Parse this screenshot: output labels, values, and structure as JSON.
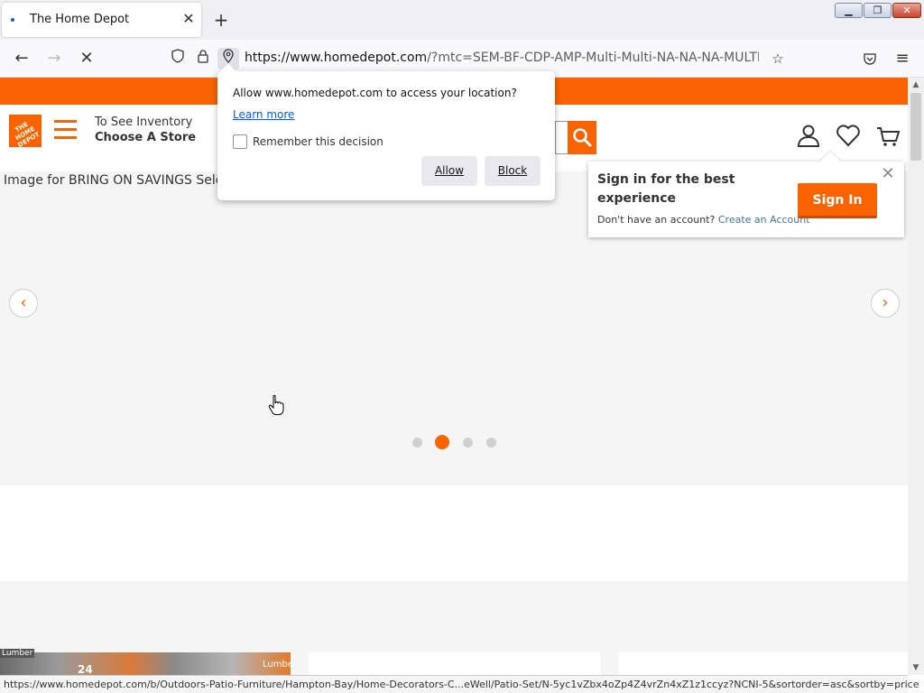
{
  "browser": {
    "tab_title": "The Home Depot",
    "new_tab_glyph": "+",
    "close_tab_glyph": "✕",
    "url_host": "https://www.homedepot.com",
    "url_rest": "/?mtc=SEM-BF-CDP-AMP-Multi-Multi-NA-NA-NA-MULTI-NA-N",
    "back_glyph": "←",
    "forward_glyph": "→",
    "stop_glyph": "✕",
    "bookmark_glyph": "☆",
    "menu_glyph": "≡",
    "status_url": "https://www.homedepot.com/b/Outdoors-Patio-Furniture/Hampton-Bay/Home-Decorators-C...eWell/Patio-Set/N-5yc1vZbx4oZp4Z4vrZn4xZ1z1ccyz?NCNI-5&sortorder=asc&sortby=price"
  },
  "header": {
    "logo_text": "THE HOME DEPOT",
    "store_line1": "To See Inventory",
    "store_line2": "Choose A Store"
  },
  "hero": {
    "alt_text": "Image for BRING ON SAVINGS Select",
    "prev_glyph": "‹",
    "next_glyph": "›",
    "dots_count": 4,
    "active_dot": 2
  },
  "tiles": {
    "label_a": "Lumber",
    "label_b": "24",
    "label_c": "Lumbe"
  },
  "signin_popup": {
    "title": "Sign in for the best experience",
    "no_account": "Don't have an account?",
    "create_link": "Create an Account",
    "button": "Sign In",
    "close_glyph": "✕"
  },
  "permission_popup": {
    "message": "Allow www.homedepot.com to access your location?",
    "learn_more": "Learn more",
    "remember": "Remember this decision",
    "allow": "Allow",
    "block": "Block"
  },
  "colors": {
    "brand_orange": "#f96302",
    "link_blue": "#0060df"
  }
}
